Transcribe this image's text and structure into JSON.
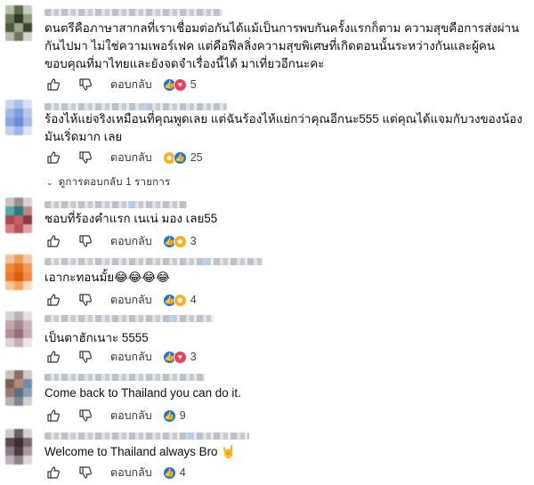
{
  "comments": [
    {
      "text": "ดนตรีคือภาษาสากลที่เราเชื่อมต่อกันได้แม้เป็นการพบกันครั้งแรกก็ตาม ความสุขคือการส่งผ่านกันไปมา ไม่ใช่ความเพอร์เฟค แต่คือฟีลลิ่งความสุขพิเศษที่เกิดตอนนั้นระหว่างกันและผู้คน ขอบคุณที่มาไทยและยังจดจำเรื่องนี้ได้ มาเที่ยวอีกนะคะ",
      "reply_label": "ตอบกลับ",
      "reactions": [
        "like-reaction-icon",
        "love-reaction-icon"
      ],
      "count": "5"
    },
    {
      "text": "ร้องไห้แย่จริงเหมือนที่คุณพูดเลย แต่ฉันร้องไห้แย่กว่าคุณอีกนะ555 แต่คุณได้แจมกับวงของน้องมันเริ่ดมาก เลย",
      "reply_label": "ตอบกลับ",
      "reactions": [
        "haha-reaction-icon",
        "like-reaction-icon"
      ],
      "count": "25"
    },
    {
      "text": "ชอบที่ร้องคำแรก เนเน่ มอง เลย55",
      "reply_label": "ตอบกลับ",
      "reactions": [
        "like-reaction-icon",
        "haha-reaction-icon"
      ],
      "count": "3"
    },
    {
      "text": "เอากะทอนมั้ย😂😂😂😂",
      "reply_label": "ตอบกลับ",
      "reactions": [
        "like-reaction-icon",
        "haha-reaction-icon"
      ],
      "count": "4"
    },
    {
      "text": "เป็นตาฮักเนาะ 5555",
      "reply_label": "ตอบกลับ",
      "reactions": [
        "like-reaction-icon",
        "love-reaction-icon"
      ],
      "count": "3"
    },
    {
      "text": "Come back to Thailand you can do it.",
      "reply_label": "ตอบกลับ",
      "reactions": [
        "like-reaction-icon"
      ],
      "count": "9"
    },
    {
      "text": "Welcome to Thailand always Bro 🤘",
      "reply_label": "ตอบกลับ",
      "reactions": [
        "like-reaction-icon"
      ],
      "count": "4"
    }
  ],
  "replies_link": "ดูการตอบกลับ 1 รายการ",
  "colors": {
    "like": "#1b74e4",
    "love": "#f33e58",
    "haha": "#f7b125"
  }
}
